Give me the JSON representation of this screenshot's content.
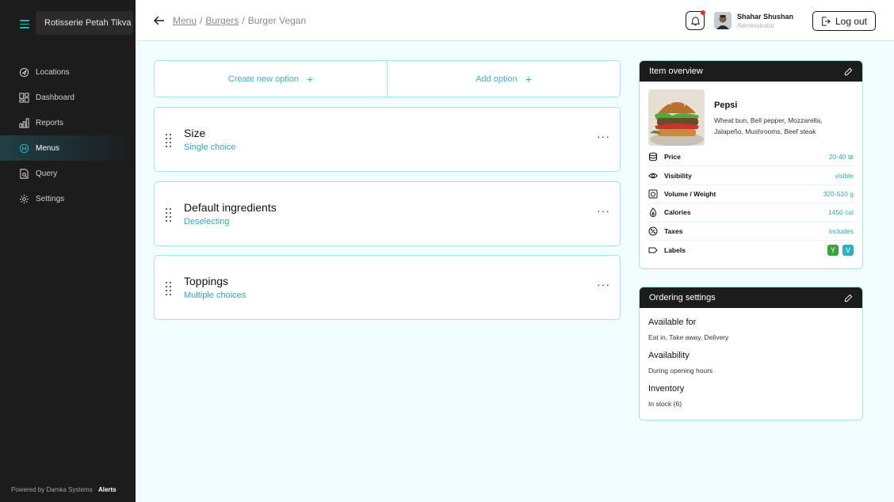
{
  "sidebar": {
    "restaurant": "Rotisserie Petah Tikva",
    "items": [
      {
        "label": "Locations",
        "icon": "location-icon"
      },
      {
        "label": "Dashboard",
        "icon": "dashboard-icon"
      },
      {
        "label": "Reports",
        "icon": "reports-icon"
      },
      {
        "label": "Menus",
        "icon": "menus-icon",
        "active": true
      },
      {
        "label": "Query",
        "icon": "query-icon"
      },
      {
        "label": "Settings",
        "icon": "gear-icon"
      }
    ],
    "footer": "Powered by Damka Systems",
    "alerts": "Alerts"
  },
  "header": {
    "breadcrumb": [
      "Menu",
      "Burgers",
      "Burger Vegan"
    ],
    "user_name": "Shahar Shushan",
    "user_role": "Administrator",
    "logout": "Log out"
  },
  "actions": {
    "create": "Create new option",
    "add": "Add option"
  },
  "options": [
    {
      "title": "Size",
      "subtitle": "Single choice"
    },
    {
      "title": "Default ingredients",
      "subtitle": "Deselecting"
    },
    {
      "title": "Toppings",
      "subtitle": "Multiple choices"
    }
  ],
  "overview": {
    "title": "Item overview",
    "name": "Pepsi",
    "description": "Wheat bun, Bell pepper, Mozzarella, Jalapeño, Mushrooms, Beef steak",
    "props": [
      {
        "label": "Price",
        "value": "20-40 ₪"
      },
      {
        "label": "Visibility",
        "value": "visible"
      },
      {
        "label": "Volume / Weight",
        "value": "320-510 g"
      },
      {
        "label": "Calories",
        "value": "1450 cal"
      },
      {
        "label": "Taxes",
        "value": "includes"
      },
      {
        "label": "Labels",
        "value": ""
      }
    ],
    "labels": [
      {
        "text": "Y",
        "color": "#3aa33a"
      },
      {
        "text": "V",
        "color": "#2cb1c4"
      }
    ]
  },
  "ordering": {
    "title": "Ordering settings",
    "sections": [
      {
        "title": "Available for",
        "value": "Eat in, Take away, Delivery"
      },
      {
        "title": "Availability",
        "value": "During opening hours"
      },
      {
        "title": "Inventory",
        "value": "In stock (6)"
      }
    ]
  },
  "colors": {
    "accent": "#2cb1c4",
    "sidebar": "#1c1c1c",
    "background": "#f2fdfd"
  }
}
